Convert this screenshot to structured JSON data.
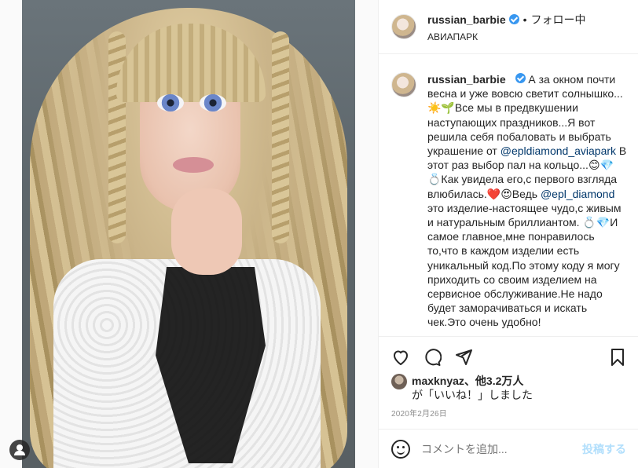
{
  "post": {
    "username": "russian_barbie",
    "follow_status": "フォロー中",
    "separator": "•",
    "location": "АВИАПАРК",
    "more_glyph": "···"
  },
  "caption": {
    "username": "russian_barbie",
    "part1": "А за окном почти весна и уже вовсю светит солнышко...☀️🌱Все мы в предвкушении наступающих праздников...Я вот решила себя побаловать и выбрать украшение от ",
    "mention1": "@epldiamond_aviapark",
    "part2": " В этот раз выбор пал на кольцо...😊💎💍Как увидела его,с первого взгляда влюбилась.❤️😍Ведь ",
    "mention2": "@epl_diamond",
    "part3": " это изделие-настоящее чудо,с живым и натуральным бриллиантом. 💍💎И самое главное,мне понравилось то,что в каждом изделии есть уникальный код.По этому коду я могу приходить со своим изделием на сервисное обслуживание.Не надо будет заморачиваться и искать чек.Это очень удобно!"
  },
  "likes": {
    "user": "maxknyaz",
    "rest": "、他3.2万人",
    "suffix": "が「いいね！」しました"
  },
  "date": "2020年2月26日",
  "comment": {
    "placeholder": "コメントを追加...",
    "post_label": "投稿する"
  },
  "icons": [
    "heart-icon",
    "comment-icon",
    "share-icon",
    "bookmark-icon",
    "emoji-icon",
    "user-tag-icon",
    "verified-icon"
  ],
  "colors": {
    "link": "#00376b",
    "verified": "#3897f0",
    "post_button_disabled": "#b2dffc",
    "muted": "#8e8e8e"
  }
}
